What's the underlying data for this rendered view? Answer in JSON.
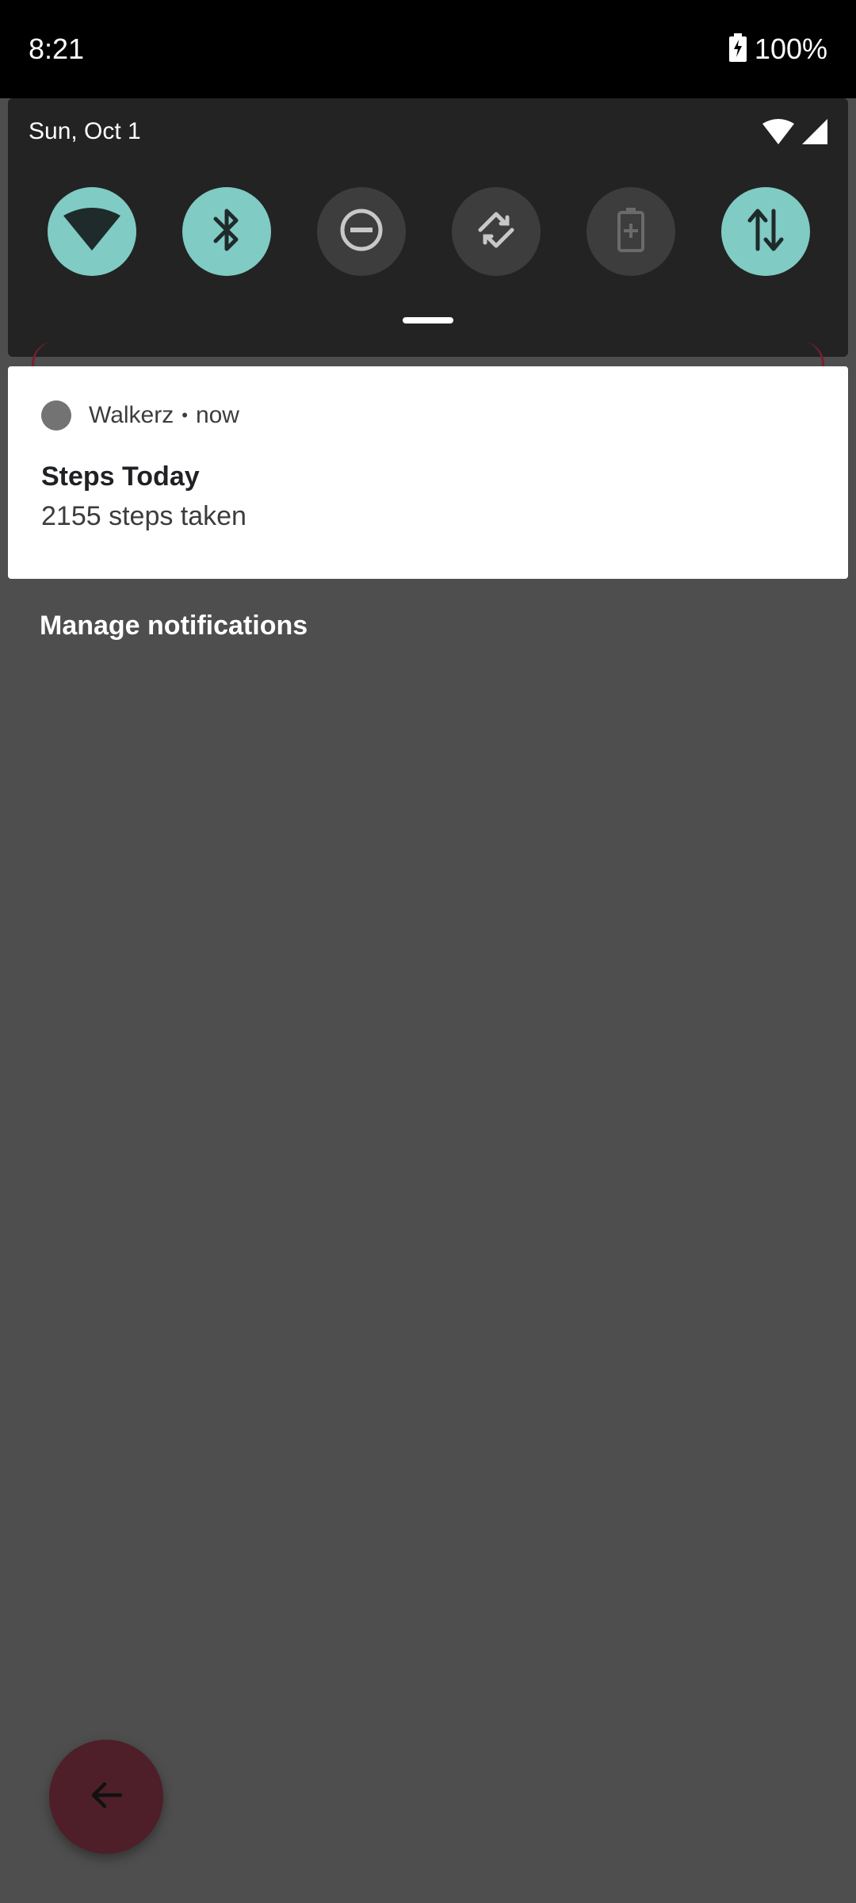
{
  "status_bar": {
    "time": "8:21",
    "battery_percent": "100%",
    "battery_icon": "battery-charging-icon"
  },
  "quick_settings": {
    "date": "Sun, Oct 1",
    "indicators": [
      "wifi-signal-icon",
      "cellular-signal-icon"
    ],
    "tiles": [
      {
        "name": "wifi-icon",
        "state": "on"
      },
      {
        "name": "bluetooth-icon",
        "state": "on"
      },
      {
        "name": "do-not-disturb-icon",
        "state": "off"
      },
      {
        "name": "auto-rotate-icon",
        "state": "off"
      },
      {
        "name": "battery-saver-icon",
        "state": "off"
      },
      {
        "name": "mobile-data-icon",
        "state": "on"
      }
    ],
    "active_color": "#80cbc4",
    "inactive_color": "#3d3d3d"
  },
  "notification": {
    "app_name": "Walkerz",
    "separator": "•",
    "time": "now",
    "title": "Steps Today",
    "text": "2155 steps taken"
  },
  "manage_notifications_label": "Manage notifications",
  "fab": {
    "icon": "arrow-back-icon",
    "color": "#4e1f28"
  }
}
